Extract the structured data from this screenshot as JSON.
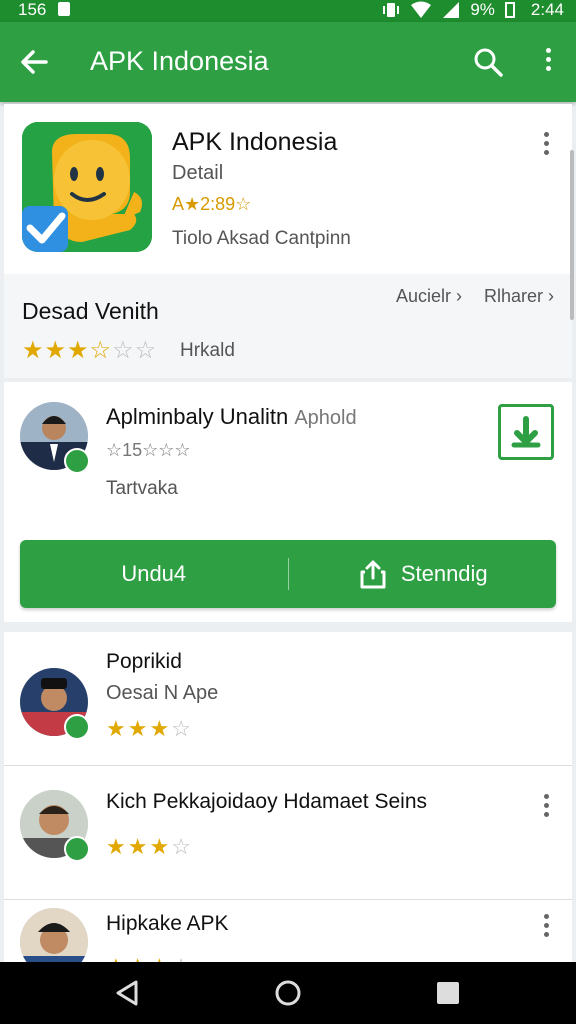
{
  "status_bar": {
    "time_left": "156",
    "battery": "9%",
    "clock": "2:44"
  },
  "app_bar": {
    "title": "APK Indonesia"
  },
  "app_card": {
    "title": "APK Indonesia",
    "subtitle": "Detail",
    "rating": "A★2:89☆",
    "caption": "Tiolo Aksad Cantpinn"
  },
  "description": {
    "heading": "Desad Venith",
    "link_1": "Aucielr ›",
    "link_2": "Rlharer ›",
    "stars": {
      "filled": 3,
      "half": 1,
      "total": 6
    },
    "stars_label": "Hrkald"
  },
  "review_card": {
    "title": "Aplminbaly Unalitn",
    "title_extra": "Aphold",
    "rating": "☆15☆☆☆",
    "caption": "Tartvaka",
    "button_left": "Undu4",
    "button_right": "Stenndig"
  },
  "list": [
    {
      "title": "Poprikid",
      "subtitle": "Oesai N Ape",
      "stars_filled": 3,
      "stars_total": 4
    },
    {
      "title": "Kich Pekkajoidaoy Hdamaet Seins",
      "subtitle": "",
      "stars_filled": 3,
      "stars_total": 4
    },
    {
      "title": "Hipkake APK",
      "subtitle": "",
      "stars_filled": 3,
      "stars_total": 4
    }
  ],
  "colors": {
    "status_bar": "#1e8d2e",
    "app_bar": "#2ea043",
    "accent": "#2ea043",
    "star": "#e0a800"
  },
  "icons": [
    "back-arrow-icon",
    "search-icon",
    "more-vert-icon",
    "download-icon",
    "share-icon",
    "back-nav-icon",
    "home-nav-icon",
    "recents-nav-icon"
  ]
}
